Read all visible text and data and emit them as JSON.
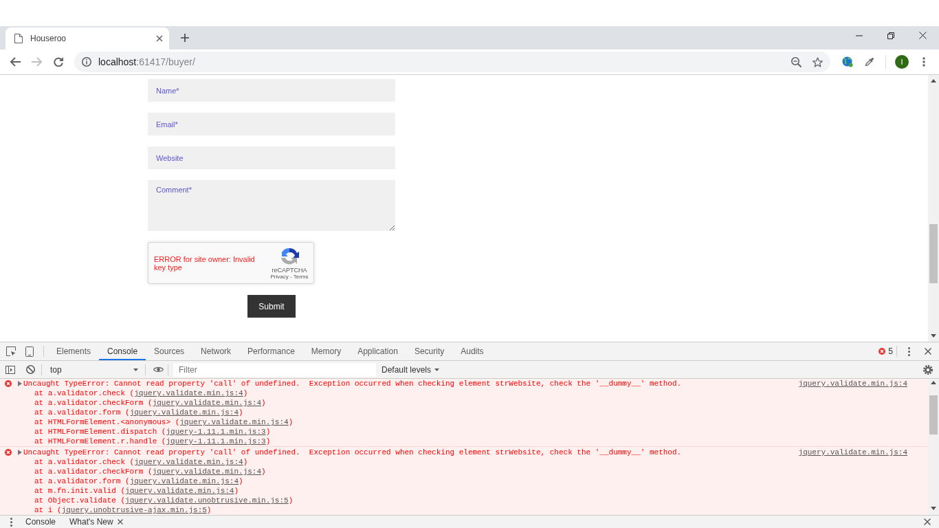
{
  "browser": {
    "tabs": [
      {
        "title": "Houseroo",
        "selected": true
      }
    ],
    "nav": [
      {
        "kind": "back",
        "disabled": false
      },
      {
        "kind": "forward",
        "disabled": true
      },
      {
        "kind": "reload",
        "disabled": false
      }
    ],
    "url": {
      "host": "localhost",
      "rest": ":61417/buyer/"
    },
    "avatar": "I"
  },
  "page": {
    "fields": [
      {
        "kind": "input",
        "placeholder": "Name*"
      },
      {
        "kind": "input",
        "placeholder": "Email*"
      },
      {
        "kind": "input",
        "placeholder": "Website"
      },
      {
        "kind": "textarea",
        "placeholder": "Comment*"
      }
    ],
    "captcha": {
      "error": "ERROR for site owner: Invalid key type",
      "brand": "reCAPTCHA",
      "links": "Privacy - Terms"
    },
    "submit": "Submit"
  },
  "devtools": {
    "tabs": [
      {
        "label": "Elements",
        "selected": false
      },
      {
        "label": "Console",
        "selected": true
      },
      {
        "label": "Sources",
        "selected": false
      },
      {
        "label": "Network",
        "selected": false
      },
      {
        "label": "Performance",
        "selected": false
      },
      {
        "label": "Memory",
        "selected": false
      },
      {
        "label": "Application",
        "selected": false
      },
      {
        "label": "Security",
        "selected": false
      },
      {
        "label": "Audits",
        "selected": false
      }
    ],
    "error_count": "5",
    "context": "top",
    "filter": {
      "placeholder": "Filter"
    },
    "levels": "Default levels",
    "messages": [
      {
        "kind": "error",
        "text": "Uncaught TypeError: Cannot read property 'call' of undefined.  Exception occurred when checking element strWebsite, check the '__dummy__' method.",
        "source": "jquery.validate.min.js:4",
        "stack": [
          {
            "call": "at a.validator.check (",
            "link": "jquery.validate.min.js:4",
            "end": ")"
          },
          {
            "call": "at a.validator.checkForm (",
            "link": "jquery.validate.min.js:4",
            "end": ")"
          },
          {
            "call": "at a.validator.form (",
            "link": "jquery.validate.min.js:4",
            "end": ")"
          },
          {
            "call": "at HTMLFormElement.<anonymous> (",
            "link": "jquery.validate.min.js:4",
            "end": ")"
          },
          {
            "call": "at HTMLFormElement.dispatch (",
            "link": "jquery-1.11.1.min.js:3",
            "end": ")"
          },
          {
            "call": "at HTMLFormElement.r.handle (",
            "link": "jquery-1.11.1.min.js:3",
            "end": ")"
          }
        ]
      },
      {
        "kind": "error",
        "text": "Uncaught TypeError: Cannot read property 'call' of undefined.  Exception occurred when checking element strWebsite, check the '__dummy__' method.",
        "source": "jquery.validate.min.js:4",
        "stack": [
          {
            "call": "at a.validator.check (",
            "link": "jquery.validate.min.js:4",
            "end": ")"
          },
          {
            "call": "at a.validator.checkForm (",
            "link": "jquery.validate.min.js:4",
            "end": ")"
          },
          {
            "call": "at a.validator.form (",
            "link": "jquery.validate.min.js:4",
            "end": ")"
          },
          {
            "call": "at m.fn.init.valid (",
            "link": "jquery.validate.min.js:4",
            "end": ")"
          },
          {
            "call": "at Object.validate (",
            "link": "jquery.validate.unobtrusive.min.js:5",
            "end": ")"
          },
          {
            "call": "at i (",
            "link": "jquery.unobtrusive-ajax.min.js:5",
            "end": ")"
          }
        ]
      }
    ]
  },
  "drawer": {
    "tabs": [
      {
        "label": "Console",
        "closable": false
      },
      {
        "label": "What's New",
        "closable": true
      }
    ]
  }
}
